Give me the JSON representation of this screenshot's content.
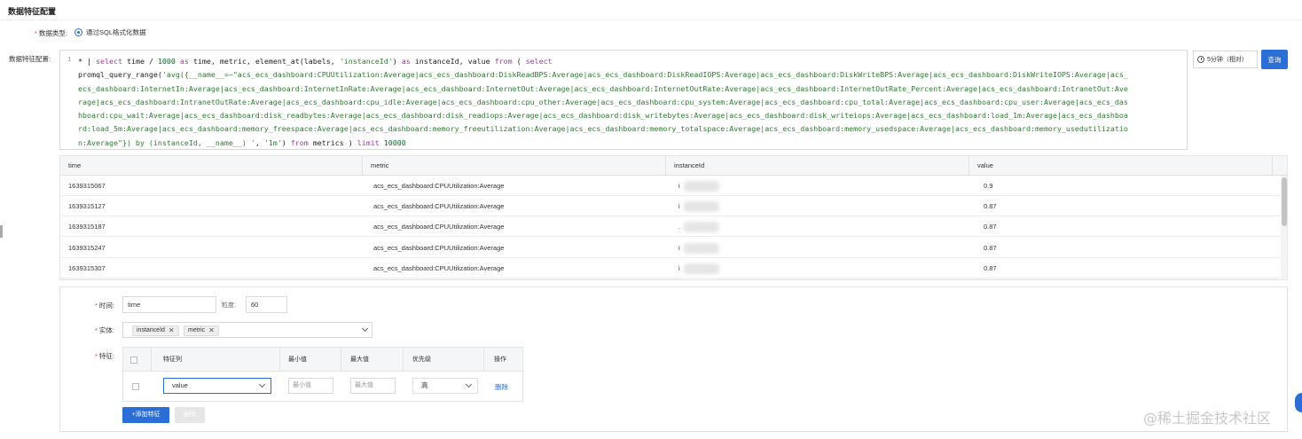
{
  "page": {
    "title": "数据特征配置",
    "watermark": "@稀土掘金技术社区"
  },
  "data_type": {
    "label": "数据类型:",
    "option": "通过SQL格式化数据"
  },
  "config": {
    "label": "数据特征配置:",
    "line_number": "1",
    "code": {
      "t1": "* | ",
      "k_select": "select",
      "t2": " time / ",
      "n1000": "1000",
      "t3": " ",
      "k_as1": "as",
      "t4": " time, metric, element_at(labels, ",
      "s_inst": "'instanceId'",
      "t5": ") ",
      "k_as2": "as",
      "t6": " instanceId, value ",
      "k_from": "from",
      "t7": " ( ",
      "k_select2": "select",
      "t8": "promql_query_range(",
      "s_promql": "'avg({__name__=~\"acs_ecs_dashboard:CPUUtilization:Average|acs_ecs_dashboard:DiskReadBPS:Average|acs_ecs_dashboard:DiskReadIOPS:Average|acs_ecs_dashboard:DiskWriteBPS:Average|acs_ecs_dashboard:DiskWriteIOPS:Average|acs_ecs_dashboard:InternetIn:Average|acs_ecs_dashboard:InternetInRate:Average|acs_ecs_dashboard:InternetOut:Average|acs_ecs_dashboard:InternetOutRate:Average|acs_ecs_dashboard:InternetOutRate_Percent:Average|acs_ecs_dashboard:IntranetOut:Average|acs_ecs_dashboard:IntranetOutRate:Average|acs_ecs_dashboard:cpu_idle:Average|acs_ecs_dashboard:cpu_other:Average|acs_ecs_dashboard:cpu_system:Average|acs_ecs_dashboard:cpu_total:Average|acs_ecs_dashboard:cpu_user:Average|acs_ecs_dashboard:cpu_wait:Average|acs_ecs_dashboard:disk_readbytes:Average|acs_ecs_dashboard:disk_readiops:Average|acs_ecs_dashboard:disk_writebytes:Average|acs_ecs_dashboard:disk_writeiops:Average|acs_ecs_dashboard:load_1m:Average|acs_ecs_dashboard:load_5m:Average|acs_ecs_dashboard:memory_freespace:Average|acs_ecs_dashboard:memory_freeutilization:Average|acs_ecs_dashboard:memory_totalspace:Average|acs_ecs_dashboard:memory_usedspace:Average|acs_ecs_dashboard:memory_usedutilization:Average\"}) by (instanceId, __name__) '",
      "t9": ", ",
      "s_1m": "'1m'",
      "t10": ") ",
      "k_from2": "from",
      "t11": " metrics ) ",
      "k_limit": "limit",
      "t12": " ",
      "n10000": "10000"
    },
    "time_range": "5分钟（相对）",
    "query_button": "查询"
  },
  "results": {
    "columns": [
      "time",
      "metric",
      "instanceId",
      "value"
    ],
    "rows": [
      {
        "time": "1639315067",
        "metric": "acs_ecs_dashboard:CPUUtilization:Average",
        "instanceId": "i",
        "value": "0.9"
      },
      {
        "time": "1639315127",
        "metric": "acs_ecs_dashboard:CPUUtilization:Average",
        "instanceId": "i",
        "value": "0.87"
      },
      {
        "time": "1639315187",
        "metric": "acs_ecs_dashboard:CPUUtilization:Average",
        "instanceId": ".",
        "value": "0.87"
      },
      {
        "time": "1639315247",
        "metric": "acs_ecs_dashboard:CPUUtilization:Average",
        "instanceId": "i",
        "value": "0.87"
      },
      {
        "time": "1639315307",
        "metric": "acs_ecs_dashboard:CPUUtilization:Average",
        "instanceId": "i",
        "value": "0.87"
      }
    ]
  },
  "form": {
    "time_label": "时间:",
    "time_value": "time",
    "granularity_label": "粒度:",
    "granularity_value": "60",
    "entity_label": "实体:",
    "entity_tags": [
      "instanceId",
      "metric"
    ],
    "feature_label": "特征:",
    "feature_table": {
      "headers": [
        "特征列",
        "最小值",
        "最大值",
        "优先级",
        "操作"
      ],
      "row": {
        "column": "value",
        "min_placeholder": "最小值",
        "max_placeholder": "最大值",
        "priority": "高",
        "action": "删除"
      }
    },
    "add_button": "+添加特征",
    "delete_button": "删除"
  }
}
